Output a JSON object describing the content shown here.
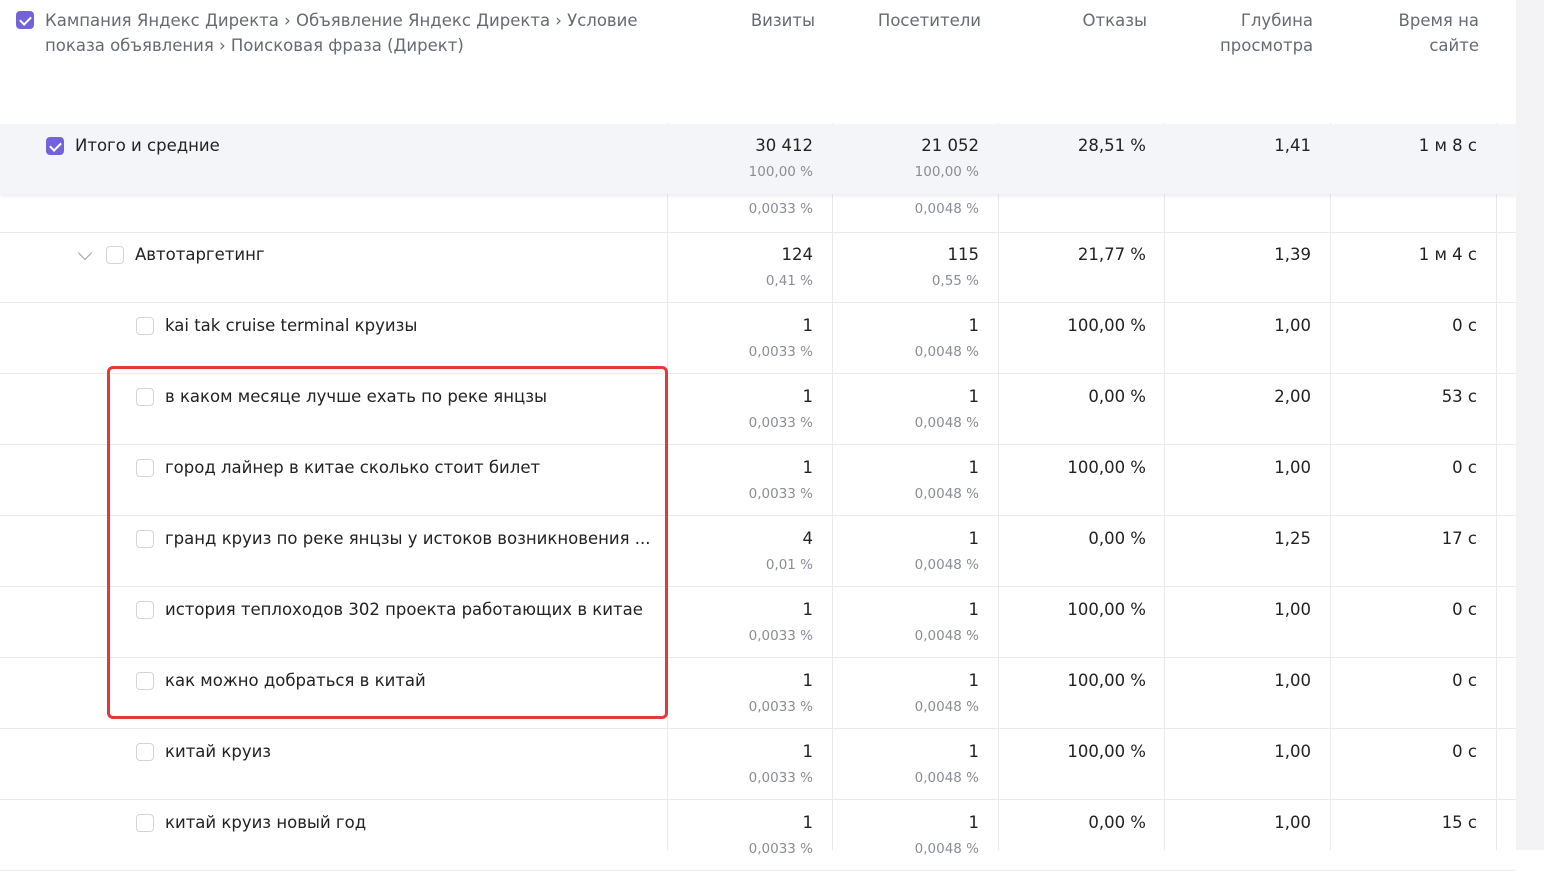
{
  "header": {
    "dimension_path": "Кампания Яндекс Директа › Объявление Яндекс Директа › Условие показа объявления › Поисковая фраза (Директ)",
    "columns": [
      "Визиты",
      "Посетители",
      "Отказы",
      "Глубина просмотра",
      "Время на сайте"
    ]
  },
  "totals": {
    "label": "Итого и средние",
    "visits": "30 412",
    "visits_pct": "100,00 %",
    "visitors": "21 052",
    "visitors_pct": "100,00 %",
    "bounce": "28,51 %",
    "depth": "1,41",
    "time": "1 м 8 с"
  },
  "partial_row": {
    "visits_pct": "0,0033 %",
    "visitors_pct": "0,0048 %"
  },
  "group": {
    "label": "Автотаргетинг",
    "visits": "124",
    "visits_pct": "0,41 %",
    "visitors": "115",
    "visitors_pct": "0,55 %",
    "bounce": "21,77 %",
    "depth": "1,39",
    "time": "1 м 4 с"
  },
  "rows": [
    {
      "label": "kai tak cruise terminal круизы",
      "visits": "1",
      "visits_pct": "0,0033 %",
      "visitors": "1",
      "visitors_pct": "0,0048 %",
      "bounce": "100,00 %",
      "depth": "1,00",
      "time": "0 с"
    },
    {
      "label": "в каком месяце лучше ехать по реке янцзы",
      "visits": "1",
      "visits_pct": "0,0033 %",
      "visitors": "1",
      "visitors_pct": "0,0048 %",
      "bounce": "0,00 %",
      "depth": "2,00",
      "time": "53 с"
    },
    {
      "label": "город лайнер в китае сколько стоит билет",
      "visits": "1",
      "visits_pct": "0,0033 %",
      "visitors": "1",
      "visitors_pct": "0,0048 %",
      "bounce": "100,00 %",
      "depth": "1,00",
      "time": "0 с"
    },
    {
      "label": "гранд круиз по реке янцзы у истоков возникновения ...",
      "visits": "4",
      "visits_pct": "0,01 %",
      "visitors": "1",
      "visitors_pct": "0,0048 %",
      "bounce": "0,00 %",
      "depth": "1,25",
      "time": "17 с"
    },
    {
      "label": "история теплоходов 302 проекта работающих в китае",
      "visits": "1",
      "visits_pct": "0,0033 %",
      "visitors": "1",
      "visitors_pct": "0,0048 %",
      "bounce": "100,00 %",
      "depth": "1,00",
      "time": "0 с"
    },
    {
      "label": "как можно добраться в китай",
      "visits": "1",
      "visits_pct": "0,0033 %",
      "visitors": "1",
      "visitors_pct": "0,0048 %",
      "bounce": "100,00 %",
      "depth": "1,00",
      "time": "0 с"
    },
    {
      "label": "китай круиз",
      "visits": "1",
      "visits_pct": "0,0033 %",
      "visitors": "1",
      "visitors_pct": "0,0048 %",
      "bounce": "100,00 %",
      "depth": "1,00",
      "time": "0 с"
    },
    {
      "label": "китай круиз новый год",
      "visits": "1",
      "visits_pct": "0,0033 %",
      "visitors": "1",
      "visitors_pct": "0,0048 %",
      "bounce": "0,00 %",
      "depth": "1,00",
      "time": "15 с"
    }
  ],
  "colors": {
    "checkbox_checked": "#7362d9",
    "highlight_border": "#e5383b",
    "totals_bg": "#f4f5f8"
  }
}
